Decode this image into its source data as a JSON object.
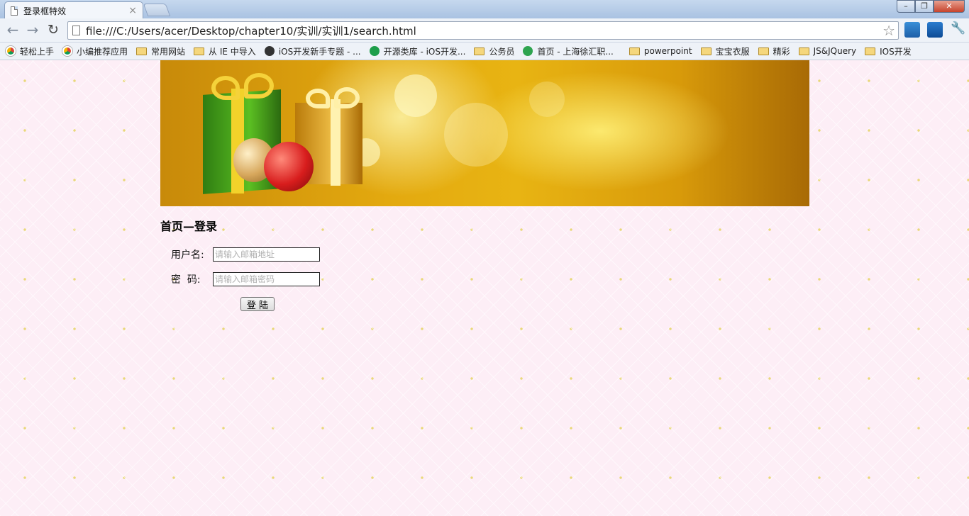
{
  "browser": {
    "tab_title": "登录框特效",
    "tab_close": "×",
    "url": "file:///C:/Users/acer/Desktop/chapter10/实训/实训1/search.html",
    "bookmarks": [
      {
        "label": "轻松上手",
        "icon": "chrome"
      },
      {
        "label": "小编推荐应用",
        "icon": "chrome"
      },
      {
        "label": "常用网站",
        "icon": "folder"
      },
      {
        "label": "从 IE 中导入",
        "icon": "folder"
      },
      {
        "label": "iOS开发新手专题 - ...",
        "icon": "github"
      },
      {
        "label": "开源类库 - iOS开发...",
        "icon": "green"
      },
      {
        "label": "公务员",
        "icon": "folder"
      },
      {
        "label": "首页 - 上海徐汇职...",
        "icon": "ie"
      },
      {
        "label": "powerpoint",
        "icon": "folder"
      },
      {
        "label": "宝宝衣服",
        "icon": "folder"
      },
      {
        "label": "精彩",
        "icon": "folder"
      },
      {
        "label": "JS&JQuery",
        "icon": "folder"
      },
      {
        "label": "IOS开发",
        "icon": "folder"
      }
    ]
  },
  "page": {
    "heading": "首页—登录",
    "username": {
      "label": "用户名:",
      "placeholder": "请输入邮箱地址",
      "value": ""
    },
    "password": {
      "label": "密  码:",
      "placeholder": "请输入邮箱密码",
      "value": ""
    },
    "login_button": "登 陆"
  },
  "colors": {
    "page_background": "#fdeef6",
    "banner_gold": "#e3a90f"
  }
}
